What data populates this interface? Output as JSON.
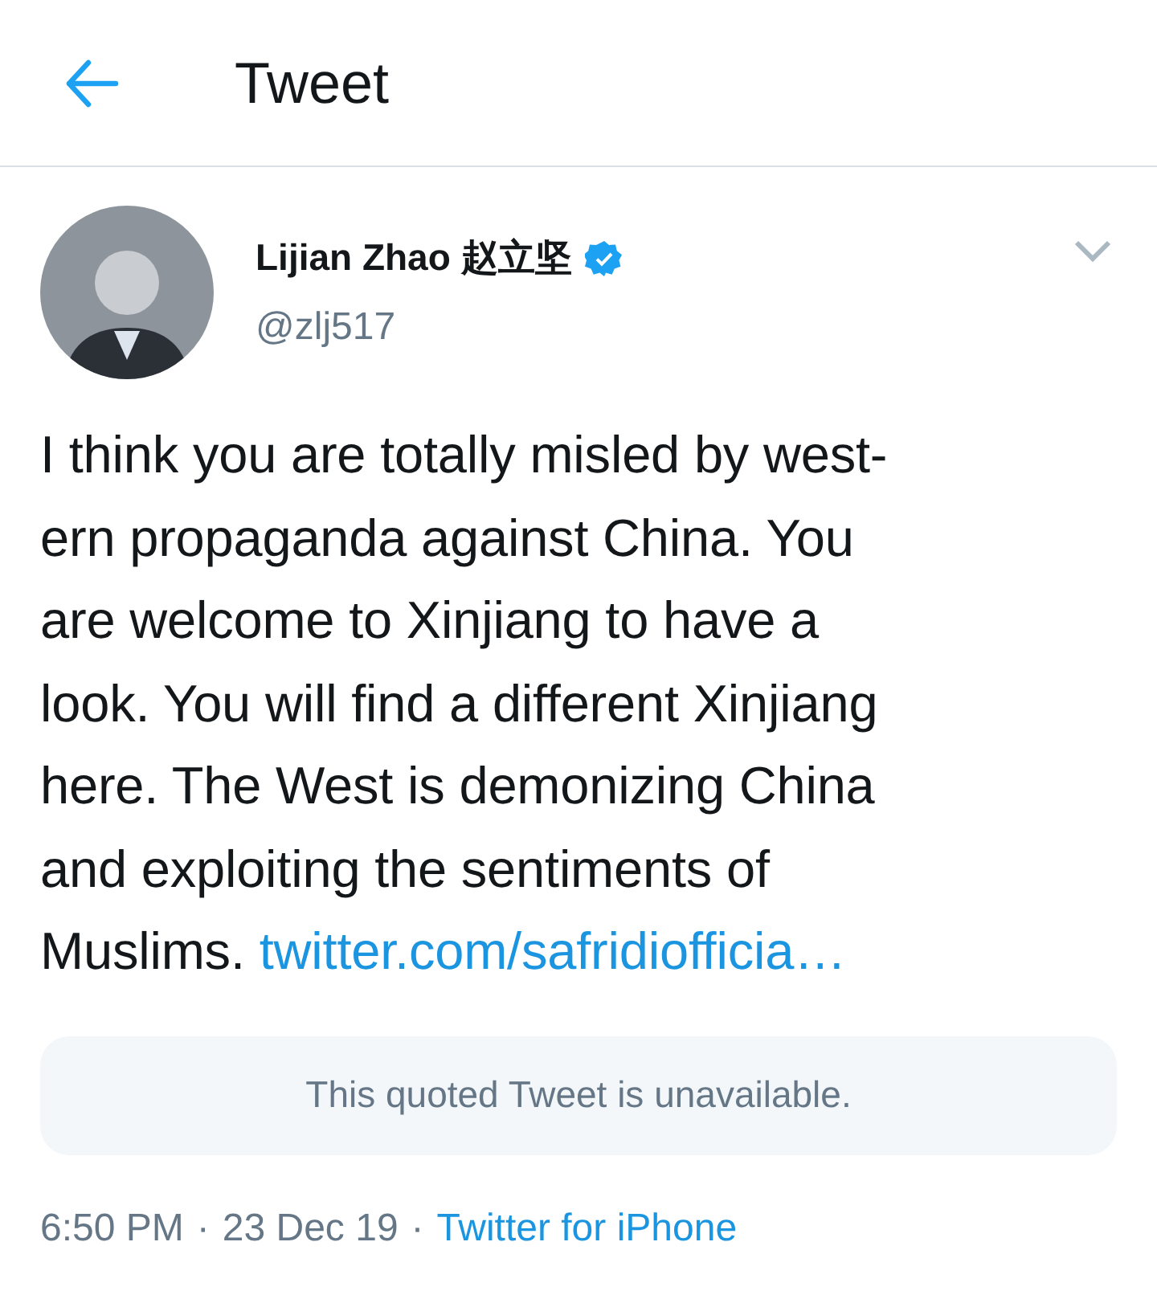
{
  "header": {
    "title": "Tweet"
  },
  "tweet": {
    "author": {
      "name": "Lijian Zhao 赵立坚",
      "verified": true,
      "handle": "@zlj517"
    },
    "lines": [
      "I think you are totally misled by west-",
      "ern propaganda against China. You",
      "are welcome to Xinjiang to have a",
      "look. You will find a different Xinjiang",
      "here. The West is demonizing China",
      "and exploiting the sentiments of",
      "Muslims."
    ],
    "link": "twitter.com/safridiofficia…",
    "quoted": "This quoted Tweet is unavailable.",
    "time": "6:50 PM",
    "separator_1": "·",
    "date": "23 Dec 19",
    "separator_2": "·",
    "source": "Twitter for iPhone"
  }
}
